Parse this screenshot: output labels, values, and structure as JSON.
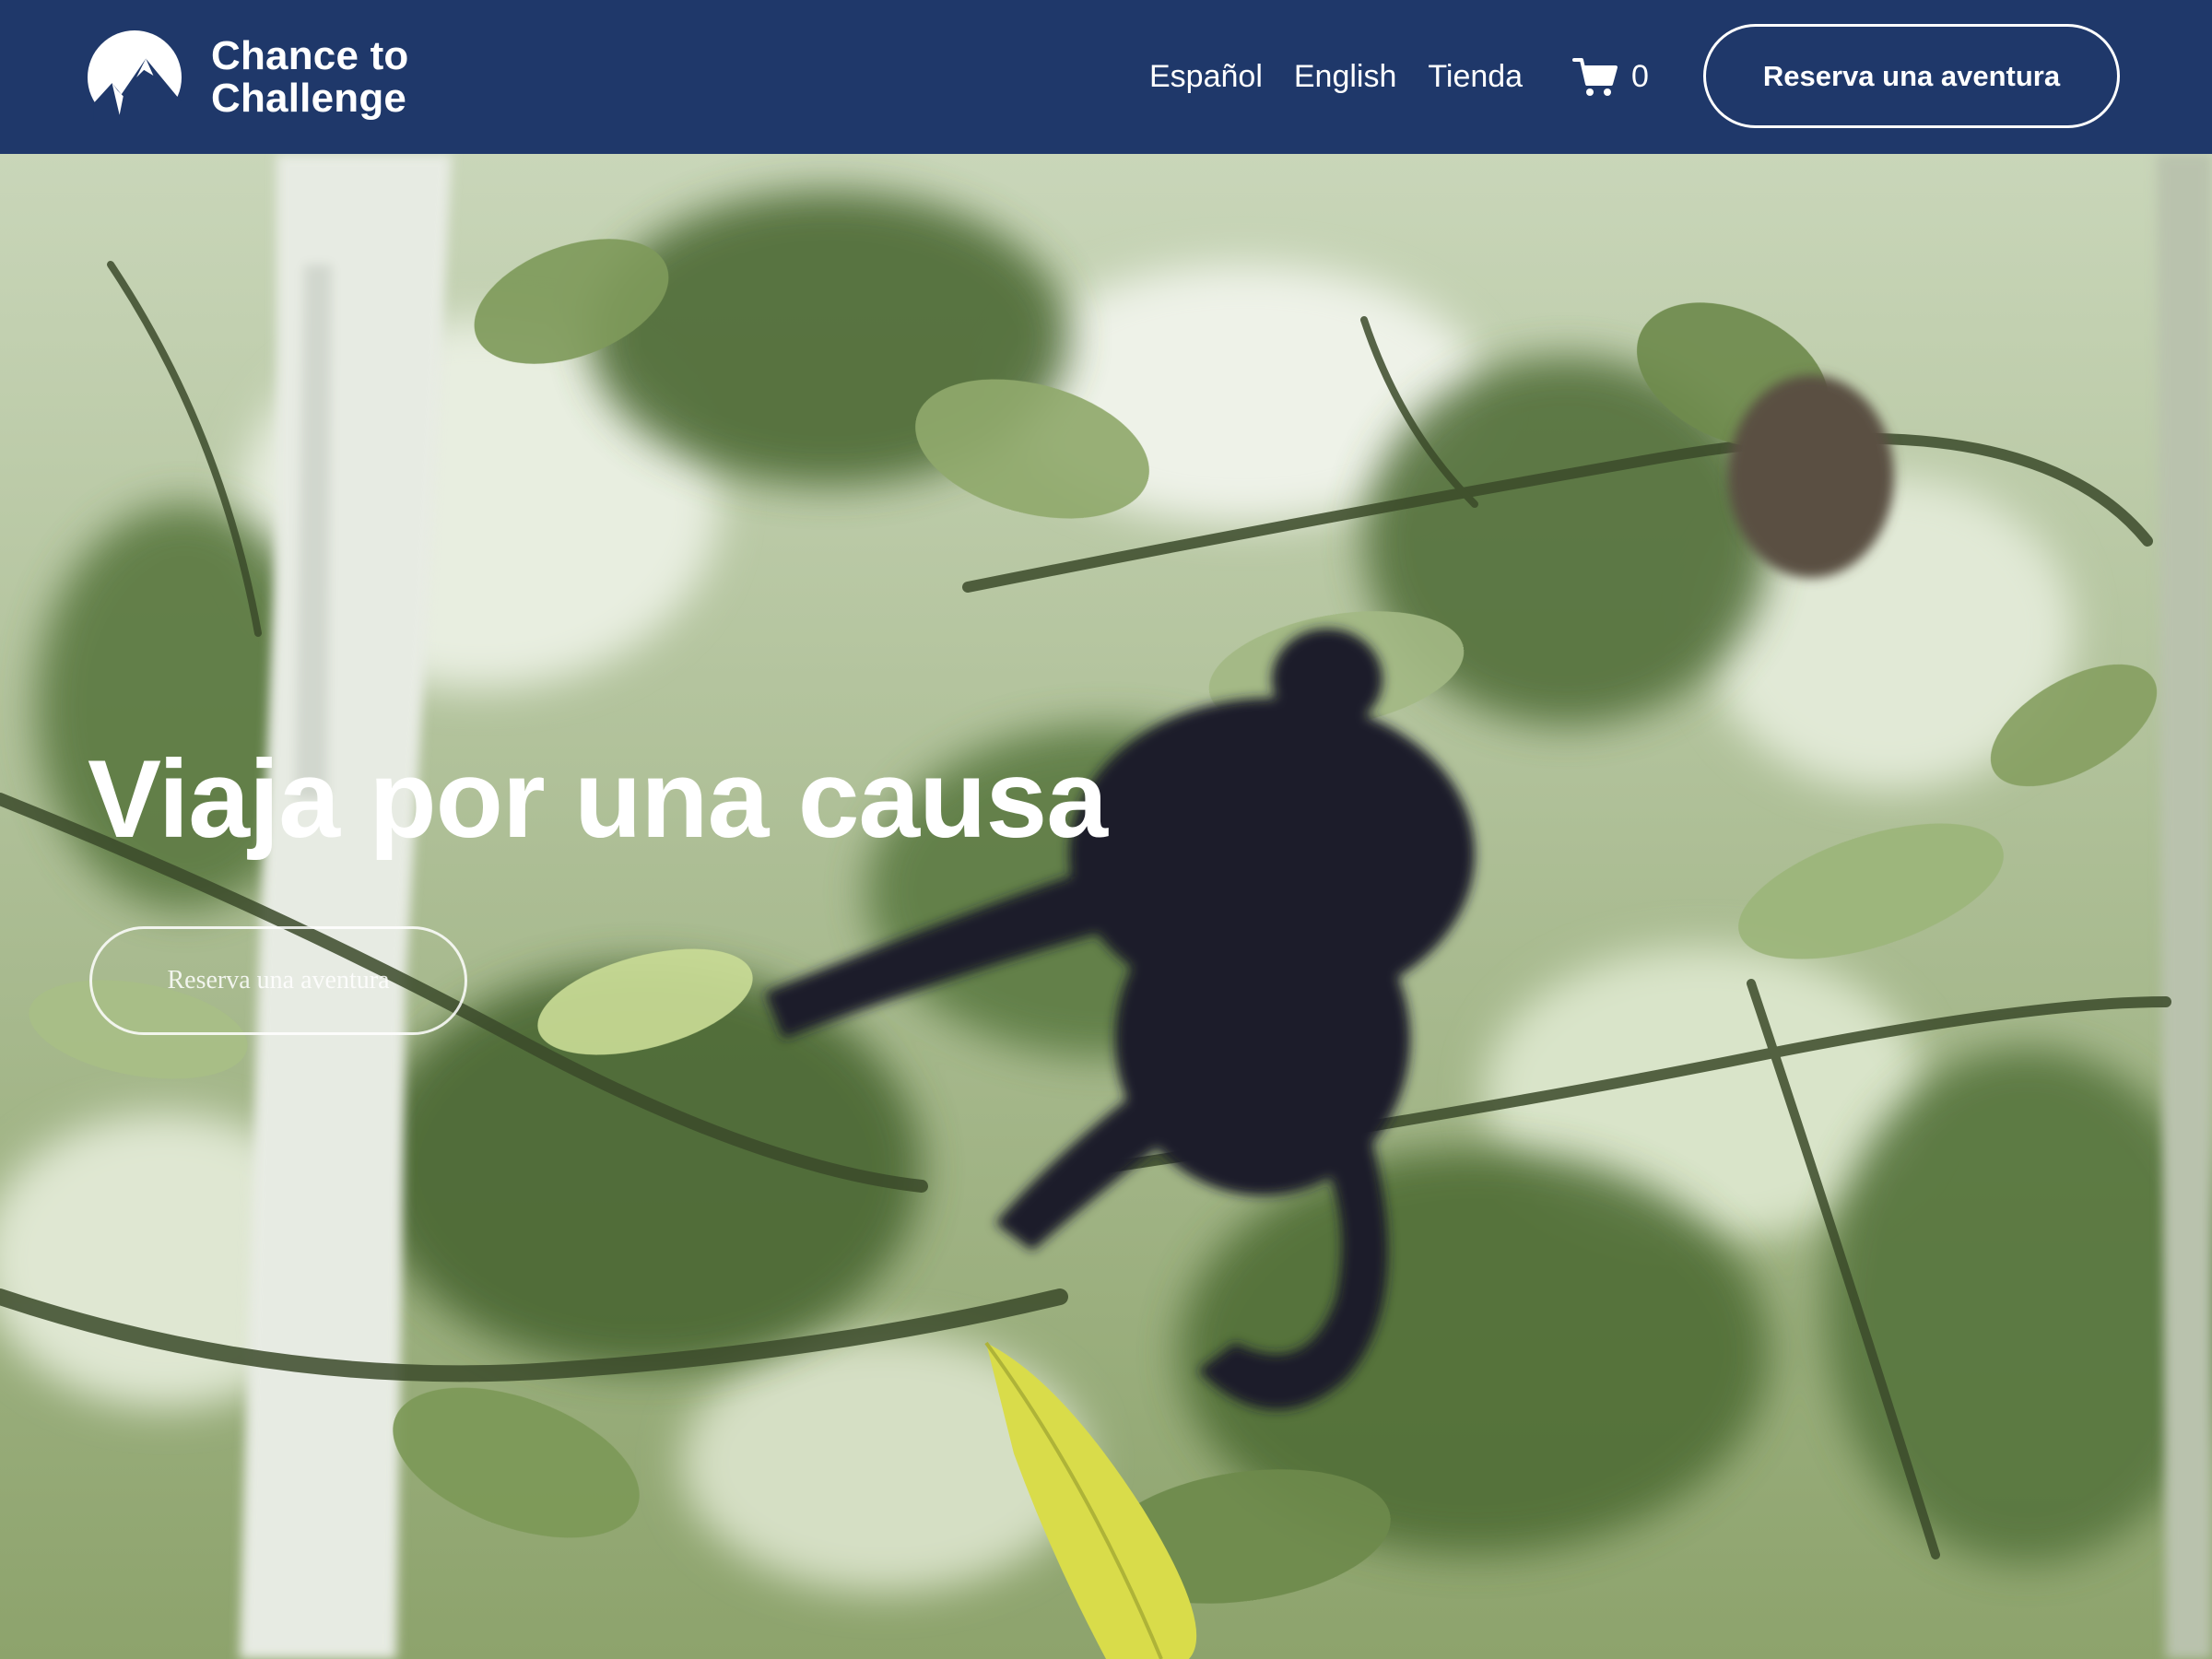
{
  "brand": {
    "name": "Chance to Challenge",
    "logo_icon": "mountain-circle-icon"
  },
  "nav": {
    "items": [
      {
        "label": "Español"
      },
      {
        "label": "English"
      },
      {
        "label": "Tienda"
      }
    ]
  },
  "cart": {
    "icon": "shopping-cart-icon",
    "count": "0"
  },
  "header_cta": {
    "label": "Reserva una aventura"
  },
  "hero": {
    "title": "Viaja por una causa",
    "cta_label": "Reserva una aventura",
    "background": "monkey-in-tree-canopy-photo"
  },
  "colors": {
    "header_bg": "#1f386a",
    "text": "#ffffff",
    "foliage_dark": "#3f5a2c",
    "foliage_light": "#a9c184",
    "monkey": "#1a1c2b"
  }
}
